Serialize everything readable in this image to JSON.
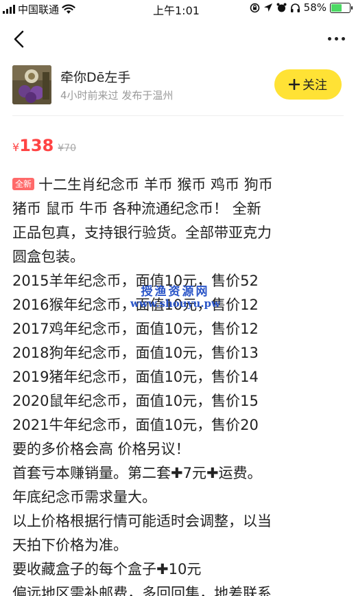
{
  "status_bar": {
    "carrier": "中国联通",
    "time": "上午1:01",
    "battery": "58%",
    "battery_level": 0.58,
    "icons": [
      "signal-icon",
      "wifi-icon",
      "rotation-lock-icon",
      "location-icon",
      "alarm-icon",
      "headphones-icon",
      "battery-icon"
    ]
  },
  "nav": {
    "back_icon": "chevron-left-icon",
    "more_icon": "more-dots-icon"
  },
  "seller": {
    "name": "牵你Dē左手",
    "visited": "4小时前来过",
    "location": "发布于温州",
    "follow_icon": "plus-icon",
    "follow_label": "关注"
  },
  "price": {
    "currency": "¥",
    "current": "138",
    "original": "¥70"
  },
  "description": {
    "tag": "全新",
    "lines": [
      "十二生肖纪念币 羊币 猴币 鸡币 狗币",
      "猪币 鼠币 牛币 各种流通纪念币！ 全新",
      "正品包真，支持银行验货。全部带亚克力",
      "圆盒包装。",
      "2015羊年纪念币，面值10元，售价52",
      "2016猴年纪念币，面值10元，售价12",
      "2017鸡年纪念币，面值10元，售价12",
      "2018狗年纪念币，面值10元，售价13",
      "2019猪年纪念币，面值10元，售价14",
      "2020鼠年纪念币，面值10元，售价15",
      "2021牛年纪念币，面值10元，售价20",
      "要的多价格会高 价格另议！",
      "首套亏本赚销量。第二套✚7元✚运费。",
      "年底纪念币需求量大。",
      "以上价格根据行情可能适时会调整，以当",
      "天拍下价格为准。",
      "要收藏盒子的每个盒子✚10元",
      "偏远地区需补邮费，多回回集，地差联系"
    ]
  },
  "watermark": {
    "title": "授渔资源网",
    "url": "www.shouyu.pw"
  },
  "colors": {
    "accent_yellow": "#ffe235",
    "price_red": "#ff4444",
    "tag_red": "#ff6a6a",
    "watermark_blue": "#2a55c8"
  }
}
